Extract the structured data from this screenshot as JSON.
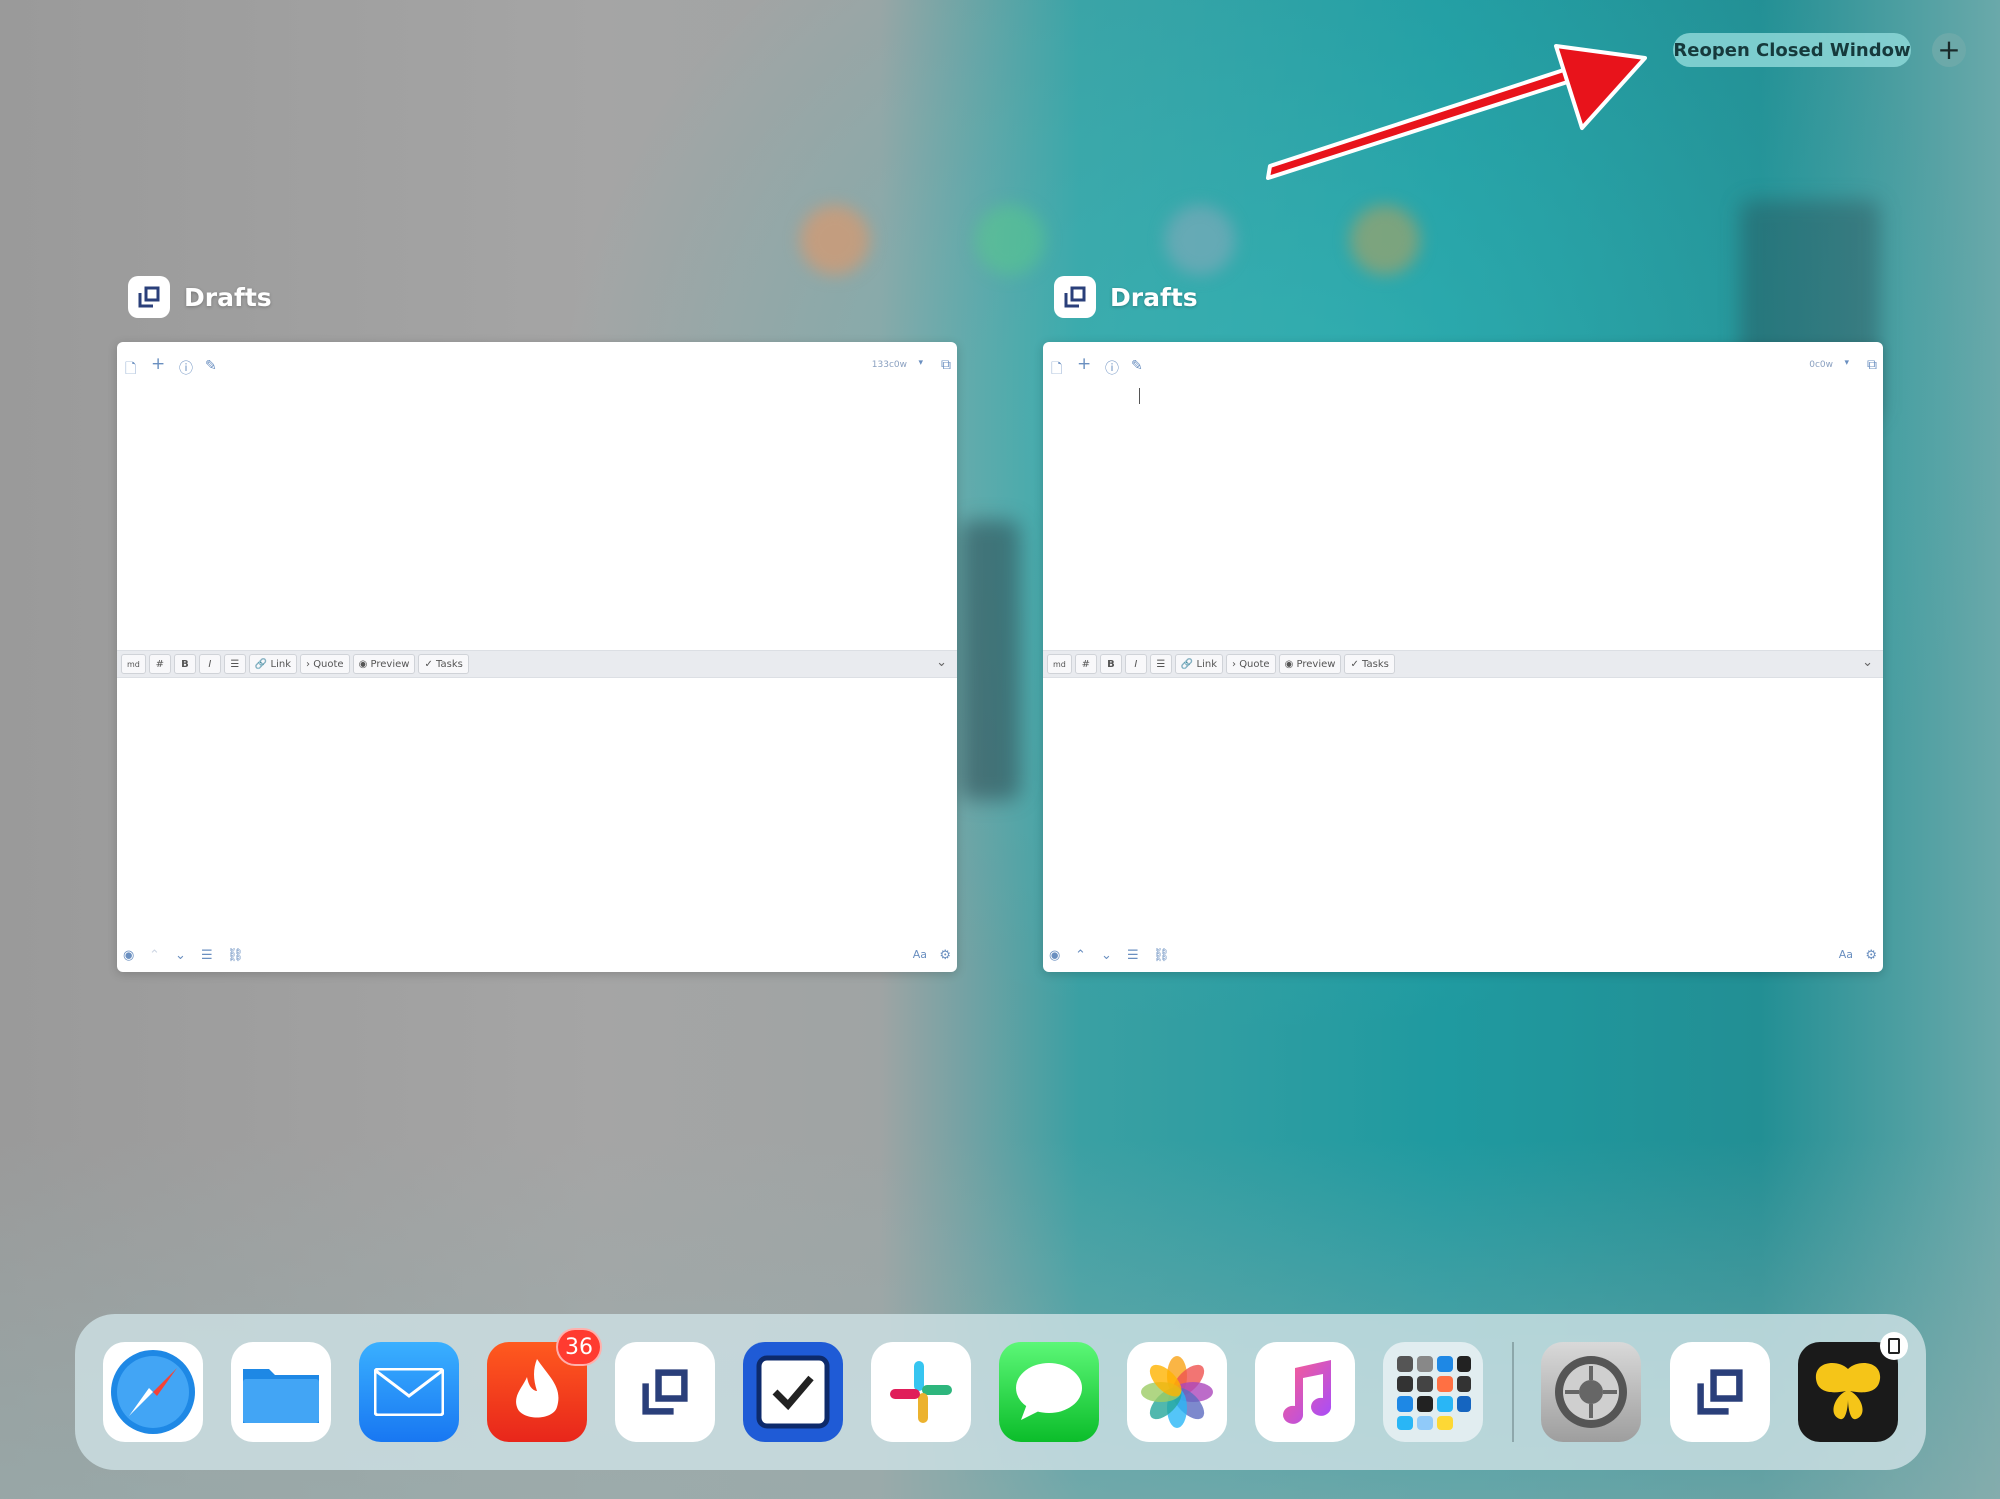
{
  "top_actions": {
    "reopen_label": "Reopen Closed Window",
    "new_window_label": "+"
  },
  "windows": [
    {
      "app_name": "Drafts",
      "word_count": "133c0w"
    },
    {
      "app_name": "Drafts",
      "word_count": "0c0w"
    }
  ],
  "keyboard_bar": {
    "md": "md",
    "hash": "#",
    "bold": "B",
    "italic": "I",
    "link": "Link",
    "quote": "Quote",
    "preview": "Preview",
    "tasks": "Tasks"
  },
  "bottom_bar": {
    "font_label": "Aa"
  },
  "dock": {
    "apps": [
      "Safari",
      "Files",
      "Mail",
      "Fire",
      "Drafts",
      "OmniFocus",
      "Slack",
      "Messages",
      "Photos",
      "Music",
      "App Folder",
      "Settings",
      "Drafts",
      "Tes"
    ],
    "badge": "36"
  },
  "colors": {
    "accent": "#6a8fc0",
    "badge": "#ff3b30",
    "arrow": "#e8131b"
  }
}
